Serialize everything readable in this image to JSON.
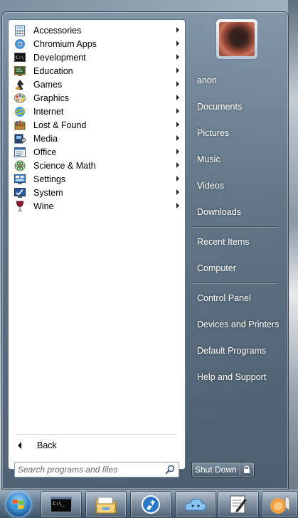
{
  "programs": [
    {
      "label": "Accessories",
      "icon": "calculator-icon"
    },
    {
      "label": "Chromium Apps",
      "icon": "chromium-icon"
    },
    {
      "label": "Development",
      "icon": "terminal-icon"
    },
    {
      "label": "Education",
      "icon": "blackboard-icon"
    },
    {
      "label": "Games",
      "icon": "chess-knight-icon"
    },
    {
      "label": "Graphics",
      "icon": "palette-icon"
    },
    {
      "label": "Internet",
      "icon": "globe-icon"
    },
    {
      "label": "Lost & Found",
      "icon": "box-icon"
    },
    {
      "label": "Media",
      "icon": "film-icon"
    },
    {
      "label": "Office",
      "icon": "document-icon"
    },
    {
      "label": "Science & Math",
      "icon": "atom-icon"
    },
    {
      "label": "Settings",
      "icon": "settings-panel-icon"
    },
    {
      "label": "System",
      "icon": "system-monitor-icon"
    },
    {
      "label": "Wine",
      "icon": "wine-glass-icon"
    }
  ],
  "back_label": "Back",
  "search": {
    "placeholder": "Search programs and files"
  },
  "right_items": {
    "user": "anon",
    "documents": "Documents",
    "pictures": "Pictures",
    "music": "Music",
    "videos": "Videos",
    "downloads": "Downloads",
    "recent": "Recent Items",
    "computer": "Computer",
    "control_panel": "Control Panel",
    "devices": "Devices and Printers",
    "defaults": "Default Programs",
    "help": "Help and Support"
  },
  "shutdown_label": "Shut Down",
  "taskbar": {
    "pinned": [
      "terminal-icon",
      "file-manager-icon",
      "browser-icon",
      "cloud-app-icon",
      "text-editor-icon",
      "media-player-icon"
    ]
  },
  "colors": {
    "accent": "#3d8fd0",
    "menu_frame": "#5c7082"
  }
}
